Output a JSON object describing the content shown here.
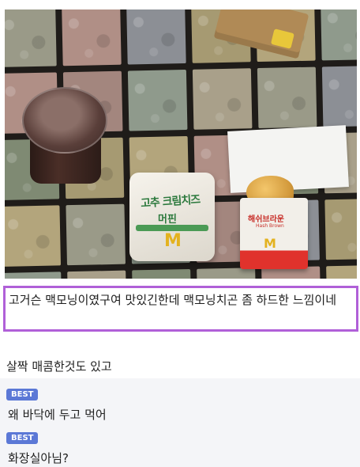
{
  "post": {
    "highlighted_text": "고거슨 맥모닝이였구여 맛있긴한데 맥모닝치곤 좀 하드한 느낌이네",
    "body_text": "살짝 매콤한것도 있고"
  },
  "photo": {
    "sandwich_label_line1": "고추 크림치즈",
    "sandwich_label_line2": "머핀",
    "hashbrown_label": "해쉬브라운",
    "hashbrown_sub": "Hash Brown",
    "logo": "M"
  },
  "comments": [
    {
      "badge": "BEST",
      "text": "왜 바닥에 두고 먹어"
    },
    {
      "badge": "BEST",
      "text": "화장실아님?"
    }
  ],
  "colors": {
    "highlight_border": "#b060d8",
    "badge": "#5b78d6"
  }
}
